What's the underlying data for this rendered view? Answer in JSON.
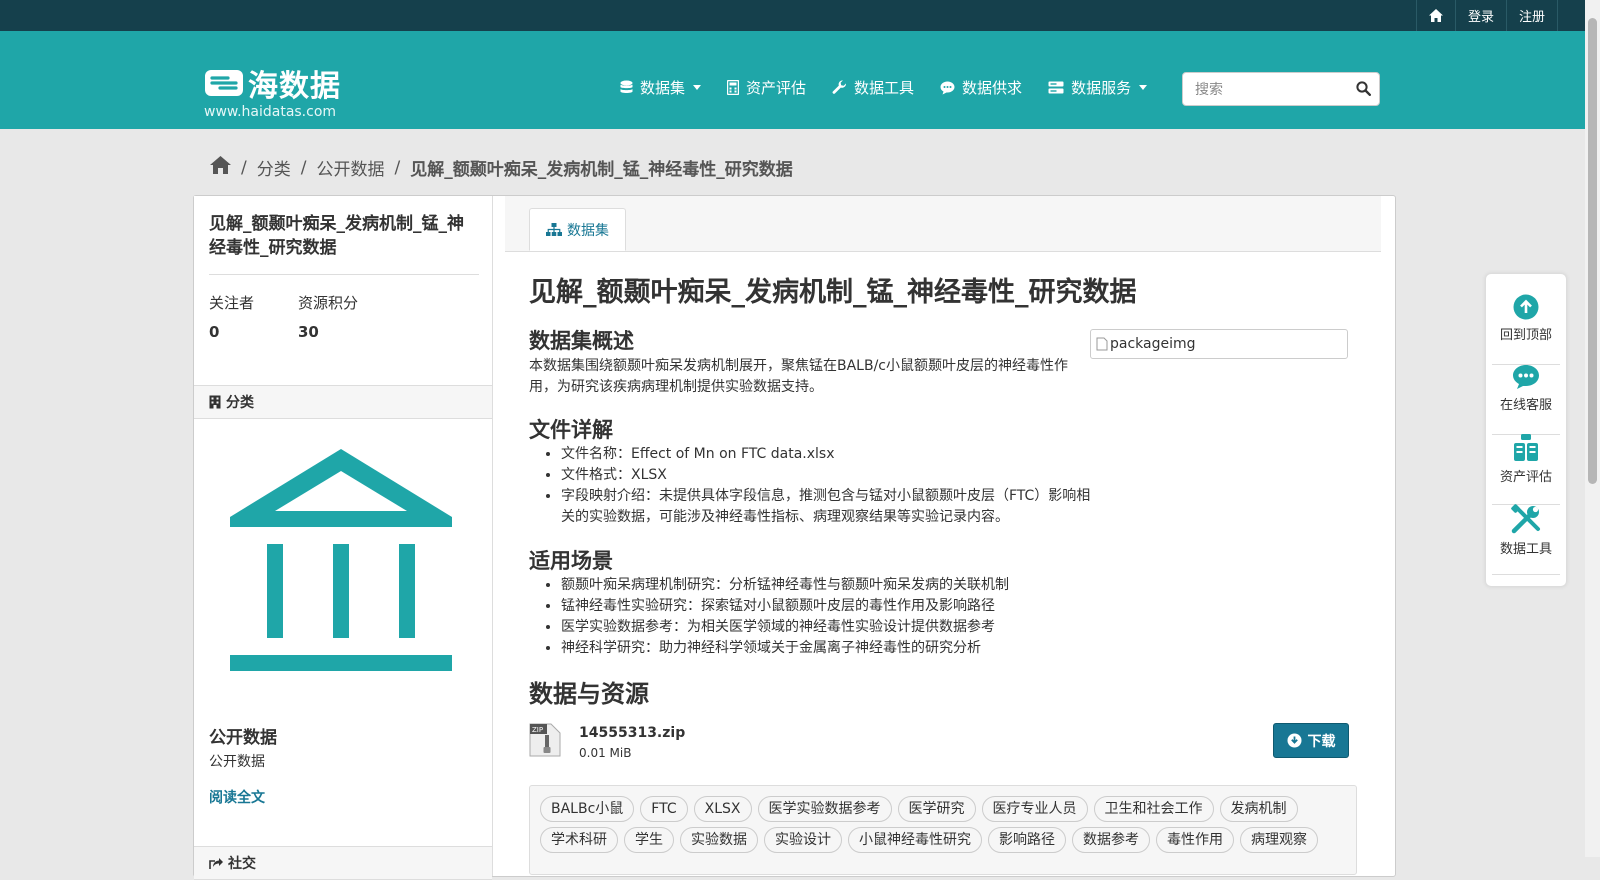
{
  "account": {
    "login": "登录",
    "register": "注册"
  },
  "brand": {
    "name": "海数据",
    "domain": "www.haidatas.com",
    "color": "#1fa6a8"
  },
  "nav": {
    "items": [
      {
        "label": "数据集",
        "icon": "database-icon",
        "dropdown": true
      },
      {
        "label": "资产评估",
        "icon": "calculator-icon"
      },
      {
        "label": "数据工具",
        "icon": "wrench-icon"
      },
      {
        "label": "数据供求",
        "icon": "chat-icon"
      },
      {
        "label": "数据服务",
        "icon": "server-icon",
        "dropdown": true
      }
    ]
  },
  "search": {
    "placeholder": "搜索",
    "value": ""
  },
  "breadcrumb": {
    "items": [
      "分类",
      "公开数据"
    ],
    "current": "见解_额颞叶痴呆_发病机制_锰_神经毒性_研究数据"
  },
  "sidebar": {
    "title": "见解_额颞叶痴呆_发病机制_锰_神经毒性_研究数据",
    "followers_label": "关注者",
    "followers_value": "0",
    "points_label": "资源积分",
    "points_value": "30",
    "category_heading": "分类",
    "org_title": "公开数据",
    "org_desc": "公开数据",
    "read_more": "阅读全文",
    "social_heading": "社交"
  },
  "content": {
    "tab": "数据集",
    "title": "见解_额颞叶痴呆_发病机制_锰_神经毒性_研究数据",
    "overview_heading": "数据集概述",
    "overview_text": "本数据集围绕额颞叶痴呆发病机制展开，聚焦锰在BALB/c小鼠额颞叶皮层的神经毒性作用，为研究该疾病病理机制提供实验数据支持。",
    "file_heading": "文件详解",
    "file_items": [
      "文件名称：Effect of Mn on FTC data.xlsx",
      "文件格式：XLSX",
      "字段映射介绍：未提供具体字段信息，推测包含与锰对小鼠额颞叶皮层（FTC）影响相关的实验数据，可能涉及神经毒性指标、病理观察结果等实验记录内容。"
    ],
    "scenario_heading": "适用场景",
    "scenario_items": [
      "额颞叶痴呆病理机制研究：分析锰神经毒性与额颞叶痴呆发病的关联机制",
      "锰神经毒性实验研究：探索锰对小鼠额颞叶皮层的毒性作用及影响路径",
      "医学实验数据参考：为相关医学领域的神经毒性实验设计提供数据参考",
      "神经科学研究：助力神经科学领域关于金属离子神经毒性的研究分析"
    ],
    "image_alt": "packageimg",
    "resources_heading": "数据与资源",
    "resource": {
      "name": "14555313.zip",
      "size": "0.01 MiB",
      "badge": "ZIP",
      "download": "下载"
    },
    "tags": [
      "BALBc小鼠",
      "FTC",
      "XLSX",
      "医学实验数据参考",
      "医学研究",
      "医疗专业人员",
      "卫生和社会工作",
      "发病机制",
      "学术科研",
      "学生",
      "实验数据",
      "实验设计",
      "小鼠神经毒性研究",
      "影响路径",
      "数据参考",
      "毒性作用",
      "病理观察"
    ]
  },
  "float_tools": [
    {
      "label": "回到顶部",
      "icon": "arrow-up-circle-icon"
    },
    {
      "label": "在线客服",
      "icon": "chat-bubble-icon"
    },
    {
      "label": "资产评估",
      "icon": "clipboard-icon"
    },
    {
      "label": "数据工具",
      "icon": "tools-icon"
    }
  ]
}
